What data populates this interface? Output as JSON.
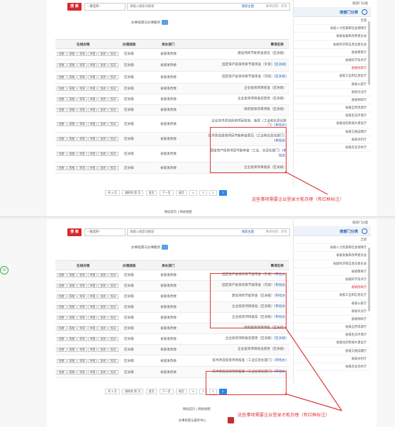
{
  "search": {
    "button_label": "搜 索",
    "select_label": "--请选择--",
    "input_text": "请输入搜索词搜索",
    "hint_link": "搜索主题",
    "hint_right": "事项名称：所有"
  },
  "toolbar": {
    "title": "办事指南与办事服务"
  },
  "table": {
    "headers": [
      "在线办理",
      "办理层级",
      "承办部门",
      "事项名称"
    ],
    "op_labels": [
      "指南",
      "表格",
      "样表",
      "申报",
      "咨询",
      "投诉"
    ],
    "rows_panel1": [
      {
        "level": "区县级",
        "dept": "省级发改委",
        "name": "建设项目节能审查意见（区县级）",
        "tag": ""
      },
      {
        "level": "区县级",
        "dept": "省级发改委",
        "name": "固定资产投资项目节能审查（外资）",
        "tag": "[区县级]"
      },
      {
        "level": "区县级",
        "dept": "省级发改委",
        "name": "固定资产投资项目节能审查（内资）",
        "tag": "[区县级]"
      },
      {
        "level": "区县级",
        "dept": "省级发改委",
        "name": "企业投资项目核准（区县级）",
        "tag": ""
      },
      {
        "level": "区县级",
        "dept": "省级发改委",
        "name": "企业投资项目备案变更（区县级）",
        "tag": ""
      },
      {
        "level": "区县级",
        "dept": "省级发改委",
        "name": "政府投资项目审批（区县级）",
        "tag": ""
      },
      {
        "level": "区县级",
        "dept": "省级发改委",
        "name": "企业技术改造投资项目核准、备案（工业和信息化部门）",
        "tag": "[审批办]"
      },
      {
        "level": "区县级",
        "dept": "省级发改委",
        "name": "技术改造投资项目节能审查意见（工业和信息化部门）",
        "tag": "[审批办]"
      },
      {
        "level": "区县级",
        "dept": "省级发改委",
        "name": "固定资产投资项目节能审查（工业、信息化部门）",
        "tag": "[审批办]"
      },
      {
        "level": "区县级",
        "dept": "省级发改委",
        "name": "企业投资项目备案（区县级）",
        "tag": ""
      }
    ],
    "rows_panel2": [
      {
        "level": "区县级",
        "dept": "省级发改委",
        "name": "固定资产投资项目节能审查（外资）",
        "tag": "[审批办]"
      },
      {
        "level": "区县级",
        "dept": "省级发改委",
        "name": "固定资产投资项目节能审查（内资）",
        "tag": "[审批办]"
      },
      {
        "level": "区县级",
        "dept": "省级发改委",
        "name": "建设项目节能审查（区县级）",
        "tag": "[审批办]"
      },
      {
        "level": "区县级",
        "dept": "省级发改委",
        "name": "企业投资项目核准（区县级）",
        "tag": "[审批办]"
      },
      {
        "level": "区县级",
        "dept": "省级发改委",
        "name": "企业投资项目备案（区县级）",
        "tag": "[审批办]"
      },
      {
        "level": "区县级",
        "dept": "省级发改委",
        "name": "政府投资项目审批（区县级）",
        "tag": ""
      },
      {
        "level": "区县级",
        "dept": "省级发改委",
        "name": "企业投资项目备案变更（区县级）",
        "tag": "[区县级]"
      },
      {
        "level": "区县级",
        "dept": "省级发改委",
        "name": "企业投资项目核准变更（区县级）",
        "tag": ""
      },
      {
        "level": "区县级",
        "dept": "省级发改委",
        "name": "技术改造投资项目核准（工业信息化部门）",
        "tag": "[审批办]"
      },
      {
        "level": "区县级",
        "dept": "省级发改委",
        "name": "技术改造投资项目备案（工业信息化部门）",
        "tag": "[审批办]"
      }
    ]
  },
  "pager": {
    "first": "首页",
    "prev": "上一页",
    "pages": [
      "1",
      "2",
      "3",
      "4"
    ],
    "current": "1",
    "next": "下一页",
    "last": "尾页",
    "jump": "跳转到 第 页",
    "total": "共 4 页"
  },
  "sidebar": {
    "header": "按部门分类",
    "tab_label": "按部门分类",
    "items": [
      "全部",
      "省级人力资源和社会保障厅",
      "省级发展和改革委员会",
      "省级经济和信息化委员会",
      "省级教育厅",
      "省级科学技术厅",
      "省级民政厅",
      "省级工业和信息化厅",
      "省级公安厅",
      "省级司法厅",
      "省级财政厅",
      "省级自然资源厅",
      "省级生态环境厅",
      "省级住房和城乡建设厅",
      "省级交通运输厅",
      "省级水利厅",
      "省级农业农村厅"
    ],
    "active_index": 6
  },
  "annotations": {
    "note1": "这些事项需要企业登录才能办理（有红框标注）",
    "note2": "这些事项需要企业登录才能办理（有红框标注）"
  },
  "footer": {
    "links": "网站首页 | 网站地图",
    "copyright": "办事指南与服务中心"
  },
  "colors": {
    "accent": "#d9272e",
    "link": "#2a64b8",
    "highlight": "#e03a3a",
    "page_active": "#2a8ae6"
  }
}
